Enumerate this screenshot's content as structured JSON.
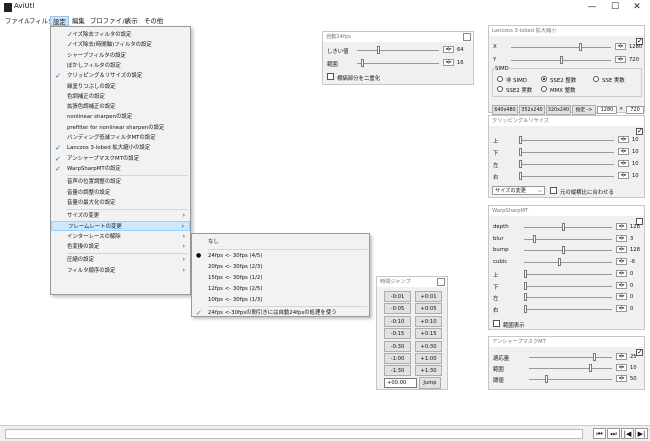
{
  "app": {
    "title": "AviUtl",
    "window_controls": [
      "—",
      "☐",
      "✕"
    ]
  },
  "menubar": [
    "ファイル",
    "フィルタ",
    "設定",
    "編集",
    "プロファイル",
    "表示",
    "その他"
  ],
  "settings_menu": [
    {
      "label": "ノイズ除去フィルタの設定",
      "checked": false
    },
    {
      "label": "ノイズ除去(時間軸)フィルタの設定",
      "checked": false
    },
    {
      "label": "シャープフィルタの設定",
      "checked": false
    },
    {
      "label": "ぼかしフィルタの設定",
      "checked": false
    },
    {
      "label": "クリッピング＆リサイズの設定",
      "checked": true
    },
    {
      "label": "縁塗りつぶしの設定",
      "checked": false
    },
    {
      "label": "色調補正の設定",
      "checked": false
    },
    {
      "label": "拡張色調補正の設定",
      "checked": false
    },
    {
      "label": "nonlinear sharpenの設定",
      "checked": false
    },
    {
      "label": "prefilter for nonlinear sharpenの設定",
      "checked": false
    },
    {
      "label": "バンディング低減フィルタMTの設定",
      "checked": false
    },
    {
      "label": "Lanczos 3-lobed 拡大縮小の設定",
      "checked": true
    },
    {
      "label": "アンシャープマスクMTの設定",
      "checked": true
    },
    {
      "label": "WarpSharpMTの設定",
      "checked": true
    },
    {
      "label": "音声の位置調整の設定",
      "checked": false
    },
    {
      "label": "音量の調整の設定",
      "checked": false
    },
    {
      "label": "音量の最大化の設定",
      "checked": false
    },
    {
      "label": "サイズの変更",
      "submenu": true
    },
    {
      "label": "フレームレートの変更",
      "submenu": true,
      "highlighted": true
    },
    {
      "label": "インターレースの解除",
      "submenu": true
    },
    {
      "label": "色変換の設定",
      "submenu": true
    },
    {
      "label": "圧縮の設定",
      "submenu": true
    },
    {
      "label": "フィルタ順序の設定",
      "submenu": true
    }
  ],
  "framerate_submenu": [
    {
      "label": "なし",
      "mark": ""
    },
    {
      "label": "24fps <- 30fps (4/5)",
      "mark": "bullet"
    },
    {
      "label": "20fps <- 30fps (2/3)",
      "mark": ""
    },
    {
      "label": "15fps <- 30fps (1/2)",
      "mark": ""
    },
    {
      "label": "12fps <- 30fps (2/5)",
      "mark": ""
    },
    {
      "label": "10fps <- 30fps (1/3)",
      "mark": ""
    },
    {
      "label": "24fps <-30fpsの間引きには自動24fpsの処理を使う",
      "mark": "check"
    }
  ],
  "auto24": {
    "title": "自動24fps",
    "rows": [
      {
        "label": "しきい値",
        "value": "64",
        "pos": 0.25
      },
      {
        "label": "範囲",
        "value": "16",
        "pos": 0.05
      }
    ],
    "checkbox": "横縞部分を二重化"
  },
  "timejump": {
    "title": "時間ジャンプ",
    "buttons": [
      [
        "-0:01",
        "+0:01"
      ],
      [
        "-0:05",
        "+0:05"
      ],
      [
        "-0:10",
        "+0:10"
      ],
      [
        "-0:15",
        "+0:15"
      ],
      [
        "-0:30",
        "+0:30"
      ],
      [
        "-1:00",
        "+1:00"
      ],
      [
        "-1:30",
        "+1:30"
      ]
    ],
    "input": "+00:00",
    "jump": "Jump"
  },
  "lanczos": {
    "title": "Lanczos 3-lobed 拡大縮小",
    "rows": [
      {
        "label": "X",
        "value": "1280",
        "pos": 0.7
      },
      {
        "label": "Y",
        "value": "720",
        "pos": 0.5
      }
    ],
    "simd_label": "SIMD",
    "radios": [
      {
        "label": "非 SIMD",
        "on": false
      },
      {
        "label": "SSE2 整数",
        "on": true
      },
      {
        "label": "SSE 実数",
        "on": false
      },
      {
        "label": "SSE2 実数",
        "on": false
      },
      {
        "label": "MMX 整数",
        "on": false
      }
    ],
    "sizes": [
      "640x480",
      "352x240",
      "320x240",
      "指定 ->"
    ],
    "w": "1280",
    "x_sep": "×",
    "h": "720"
  },
  "clip": {
    "title": "クリッピング＆リサイズ",
    "rows": [
      {
        "label": "上",
        "value": "10",
        "pos": 0.0
      },
      {
        "label": "下",
        "value": "10",
        "pos": 0.0
      },
      {
        "label": "左",
        "value": "10",
        "pos": 0.0
      },
      {
        "label": "右",
        "value": "10",
        "pos": 0.0
      }
    ],
    "select": "サイズの変更",
    "checkbox": "元の縦横比に合わせる"
  },
  "warp": {
    "title": "WarpSharpMT",
    "rows": [
      {
        "label": "depth",
        "value": "128",
        "pos": 0.45
      },
      {
        "label": "blur",
        "value": "3",
        "pos": 0.1
      },
      {
        "label": "bump",
        "value": "128",
        "pos": 0.45
      },
      {
        "label": "cubic",
        "value": "-6",
        "pos": 0.4
      },
      {
        "label": "上",
        "value": "0",
        "pos": 0.0
      },
      {
        "label": "下",
        "value": "0",
        "pos": 0.0
      },
      {
        "label": "左",
        "value": "0",
        "pos": 0.0
      },
      {
        "label": "右",
        "value": "0",
        "pos": 0.0
      }
    ],
    "checkbox": "範囲表示"
  },
  "unsharp": {
    "title": "アンシャープマスクMT",
    "rows": [
      {
        "label": "適応量",
        "value": "25",
        "pos": 0.8
      },
      {
        "label": "範囲",
        "value": "10",
        "pos": 0.75
      },
      {
        "label": "閾値",
        "value": "50",
        "pos": 0.2
      }
    ]
  },
  "statusbar": {
    "buttons": [
      "⏮",
      "⏭",
      "|◀",
      "▶|"
    ]
  }
}
